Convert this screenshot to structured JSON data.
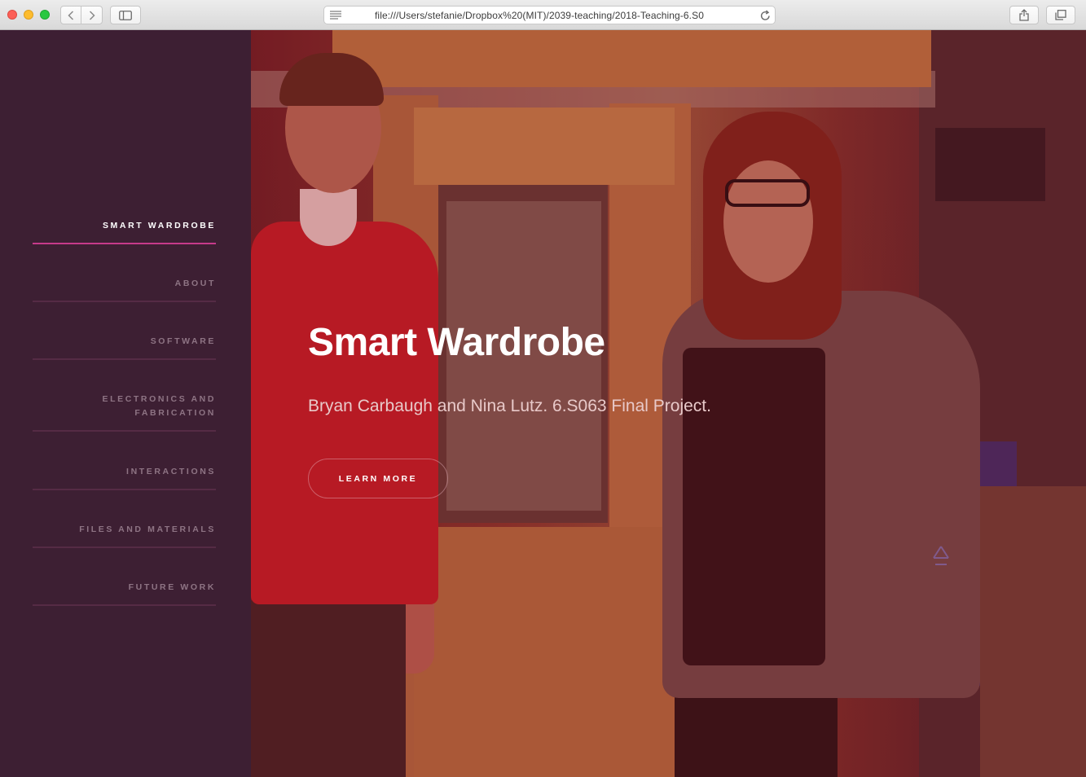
{
  "browser": {
    "url": "file:///Users/stefanie/Dropbox%20(MIT)/2039-teaching/2018-Teaching-6.S0"
  },
  "sidebar": {
    "items": [
      {
        "label": "Smart Wardrobe",
        "active": true
      },
      {
        "label": "About",
        "active": false
      },
      {
        "label": "Software",
        "active": false
      },
      {
        "label": "Electronics and Fabrication",
        "active": false
      },
      {
        "label": "Interactions",
        "active": false
      },
      {
        "label": "Files and Materials",
        "active": false
      },
      {
        "label": "Future Work",
        "active": false
      }
    ]
  },
  "hero": {
    "title": "Smart Wardrobe",
    "subtitle": "Bryan Carbaugh and Nina Lutz. 6.S063 Final Project.",
    "button_label": "LEARN MORE",
    "image": "photo-two-people-wooden-wardrobe"
  },
  "colors": {
    "sidebar_bg": "#3d1f33",
    "accent": "#c63a8b",
    "nav_text": "#8e7484",
    "active_text": "#ffffff"
  }
}
